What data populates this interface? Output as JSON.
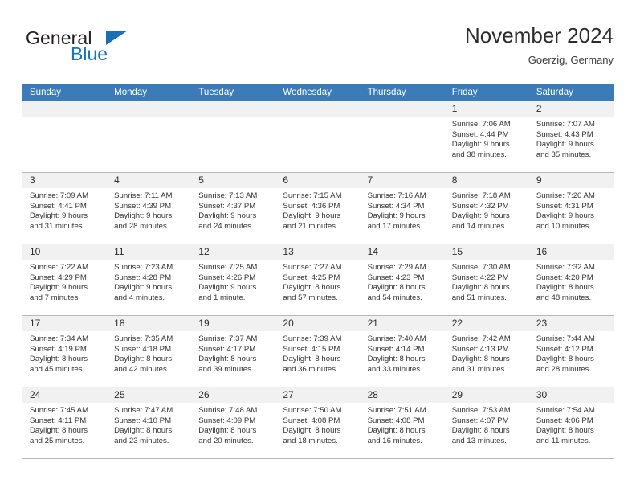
{
  "brand": {
    "word1": "General",
    "word2": "Blue",
    "triangle_color": "#1b6fb4",
    "blue_color": "#1b75bb"
  },
  "header": {
    "title": "November 2024",
    "location": "Goerzig, Germany"
  },
  "theme": {
    "header_bar": "#3b7cb8",
    "daynum_bar": "#f1f1f1",
    "grid_line": "#b9b9b9"
  },
  "weekdays": [
    "Sunday",
    "Monday",
    "Tuesday",
    "Wednesday",
    "Thursday",
    "Friday",
    "Saturday"
  ],
  "weeks": [
    [
      {
        "day": "",
        "empty": true
      },
      {
        "day": "",
        "empty": true
      },
      {
        "day": "",
        "empty": true
      },
      {
        "day": "",
        "empty": true
      },
      {
        "day": "",
        "empty": true
      },
      {
        "day": "1",
        "sunrise": "Sunrise: 7:06 AM",
        "sunset": "Sunset: 4:44 PM",
        "daylight1": "Daylight: 9 hours",
        "daylight2": "and 38 minutes."
      },
      {
        "day": "2",
        "sunrise": "Sunrise: 7:07 AM",
        "sunset": "Sunset: 4:43 PM",
        "daylight1": "Daylight: 9 hours",
        "daylight2": "and 35 minutes."
      }
    ],
    [
      {
        "day": "3",
        "sunrise": "Sunrise: 7:09 AM",
        "sunset": "Sunset: 4:41 PM",
        "daylight1": "Daylight: 9 hours",
        "daylight2": "and 31 minutes."
      },
      {
        "day": "4",
        "sunrise": "Sunrise: 7:11 AM",
        "sunset": "Sunset: 4:39 PM",
        "daylight1": "Daylight: 9 hours",
        "daylight2": "and 28 minutes."
      },
      {
        "day": "5",
        "sunrise": "Sunrise: 7:13 AM",
        "sunset": "Sunset: 4:37 PM",
        "daylight1": "Daylight: 9 hours",
        "daylight2": "and 24 minutes."
      },
      {
        "day": "6",
        "sunrise": "Sunrise: 7:15 AM",
        "sunset": "Sunset: 4:36 PM",
        "daylight1": "Daylight: 9 hours",
        "daylight2": "and 21 minutes."
      },
      {
        "day": "7",
        "sunrise": "Sunrise: 7:16 AM",
        "sunset": "Sunset: 4:34 PM",
        "daylight1": "Daylight: 9 hours",
        "daylight2": "and 17 minutes."
      },
      {
        "day": "8",
        "sunrise": "Sunrise: 7:18 AM",
        "sunset": "Sunset: 4:32 PM",
        "daylight1": "Daylight: 9 hours",
        "daylight2": "and 14 minutes."
      },
      {
        "day": "9",
        "sunrise": "Sunrise: 7:20 AM",
        "sunset": "Sunset: 4:31 PM",
        "daylight1": "Daylight: 9 hours",
        "daylight2": "and 10 minutes."
      }
    ],
    [
      {
        "day": "10",
        "sunrise": "Sunrise: 7:22 AM",
        "sunset": "Sunset: 4:29 PM",
        "daylight1": "Daylight: 9 hours",
        "daylight2": "and 7 minutes."
      },
      {
        "day": "11",
        "sunrise": "Sunrise: 7:23 AM",
        "sunset": "Sunset: 4:28 PM",
        "daylight1": "Daylight: 9 hours",
        "daylight2": "and 4 minutes."
      },
      {
        "day": "12",
        "sunrise": "Sunrise: 7:25 AM",
        "sunset": "Sunset: 4:26 PM",
        "daylight1": "Daylight: 9 hours",
        "daylight2": "and 1 minute."
      },
      {
        "day": "13",
        "sunrise": "Sunrise: 7:27 AM",
        "sunset": "Sunset: 4:25 PM",
        "daylight1": "Daylight: 8 hours",
        "daylight2": "and 57 minutes."
      },
      {
        "day": "14",
        "sunrise": "Sunrise: 7:29 AM",
        "sunset": "Sunset: 4:23 PM",
        "daylight1": "Daylight: 8 hours",
        "daylight2": "and 54 minutes."
      },
      {
        "day": "15",
        "sunrise": "Sunrise: 7:30 AM",
        "sunset": "Sunset: 4:22 PM",
        "daylight1": "Daylight: 8 hours",
        "daylight2": "and 51 minutes."
      },
      {
        "day": "16",
        "sunrise": "Sunrise: 7:32 AM",
        "sunset": "Sunset: 4:20 PM",
        "daylight1": "Daylight: 8 hours",
        "daylight2": "and 48 minutes."
      }
    ],
    [
      {
        "day": "17",
        "sunrise": "Sunrise: 7:34 AM",
        "sunset": "Sunset: 4:19 PM",
        "daylight1": "Daylight: 8 hours",
        "daylight2": "and 45 minutes."
      },
      {
        "day": "18",
        "sunrise": "Sunrise: 7:35 AM",
        "sunset": "Sunset: 4:18 PM",
        "daylight1": "Daylight: 8 hours",
        "daylight2": "and 42 minutes."
      },
      {
        "day": "19",
        "sunrise": "Sunrise: 7:37 AM",
        "sunset": "Sunset: 4:17 PM",
        "daylight1": "Daylight: 8 hours",
        "daylight2": "and 39 minutes."
      },
      {
        "day": "20",
        "sunrise": "Sunrise: 7:39 AM",
        "sunset": "Sunset: 4:15 PM",
        "daylight1": "Daylight: 8 hours",
        "daylight2": "and 36 minutes."
      },
      {
        "day": "21",
        "sunrise": "Sunrise: 7:40 AM",
        "sunset": "Sunset: 4:14 PM",
        "daylight1": "Daylight: 8 hours",
        "daylight2": "and 33 minutes."
      },
      {
        "day": "22",
        "sunrise": "Sunrise: 7:42 AM",
        "sunset": "Sunset: 4:13 PM",
        "daylight1": "Daylight: 8 hours",
        "daylight2": "and 31 minutes."
      },
      {
        "day": "23",
        "sunrise": "Sunrise: 7:44 AM",
        "sunset": "Sunset: 4:12 PM",
        "daylight1": "Daylight: 8 hours",
        "daylight2": "and 28 minutes."
      }
    ],
    [
      {
        "day": "24",
        "sunrise": "Sunrise: 7:45 AM",
        "sunset": "Sunset: 4:11 PM",
        "daylight1": "Daylight: 8 hours",
        "daylight2": "and 25 minutes."
      },
      {
        "day": "25",
        "sunrise": "Sunrise: 7:47 AM",
        "sunset": "Sunset: 4:10 PM",
        "daylight1": "Daylight: 8 hours",
        "daylight2": "and 23 minutes."
      },
      {
        "day": "26",
        "sunrise": "Sunrise: 7:48 AM",
        "sunset": "Sunset: 4:09 PM",
        "daylight1": "Daylight: 8 hours",
        "daylight2": "and 20 minutes."
      },
      {
        "day": "27",
        "sunrise": "Sunrise: 7:50 AM",
        "sunset": "Sunset: 4:08 PM",
        "daylight1": "Daylight: 8 hours",
        "daylight2": "and 18 minutes."
      },
      {
        "day": "28",
        "sunrise": "Sunrise: 7:51 AM",
        "sunset": "Sunset: 4:08 PM",
        "daylight1": "Daylight: 8 hours",
        "daylight2": "and 16 minutes."
      },
      {
        "day": "29",
        "sunrise": "Sunrise: 7:53 AM",
        "sunset": "Sunset: 4:07 PM",
        "daylight1": "Daylight: 8 hours",
        "daylight2": "and 13 minutes."
      },
      {
        "day": "30",
        "sunrise": "Sunrise: 7:54 AM",
        "sunset": "Sunset: 4:06 PM",
        "daylight1": "Daylight: 8 hours",
        "daylight2": "and 11 minutes."
      }
    ]
  ]
}
